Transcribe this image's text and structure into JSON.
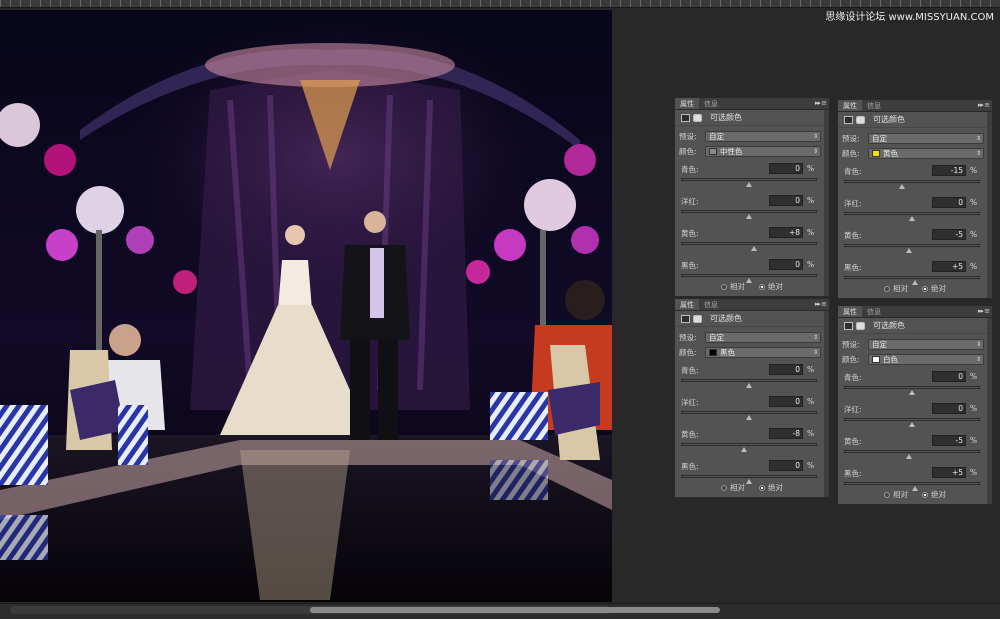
{
  "watermark": "思缘设计论坛 www.MISSYUAN.COM",
  "panel_tabs": {
    "properties": "属性",
    "info": "信息"
  },
  "panel_title": "可选颜色",
  "labels": {
    "preset": "预设:",
    "colors": "颜色:",
    "cyan": "青色:",
    "magenta": "洋红:",
    "yellow": "黄色:",
    "black": "黑色:",
    "percent": "%",
    "relative": "相对",
    "absolute": "绝对"
  },
  "panels": [
    {
      "id": "neutrals",
      "preset": "自定",
      "color_name": "中性色",
      "swatch": "#8a8a8a",
      "values": {
        "cyan": "0",
        "magenta": "0",
        "yellow": "+8",
        "black": "0"
      },
      "method": "absolute"
    },
    {
      "id": "yellows",
      "preset": "自定",
      "color_name": "黄色",
      "swatch": "#f2e000",
      "values": {
        "cyan": "-15",
        "magenta": "0",
        "yellow": "-5",
        "black": "+5"
      },
      "method": "absolute"
    },
    {
      "id": "blacks",
      "preset": "自定",
      "color_name": "黑色",
      "swatch": "#000000",
      "values": {
        "cyan": "0",
        "magenta": "0",
        "yellow": "-8",
        "black": "0"
      },
      "method": "absolute"
    },
    {
      "id": "whites",
      "preset": "自定",
      "color_name": "白色",
      "swatch": "#ffffff",
      "values": {
        "cyan": "0",
        "magenta": "0",
        "yellow": "-5",
        "black": "+5"
      },
      "method": "absolute"
    }
  ],
  "colors": {
    "ui_bg": "#282828",
    "panel_bg": "#535353",
    "tab_bar": "#3d3d3d"
  }
}
